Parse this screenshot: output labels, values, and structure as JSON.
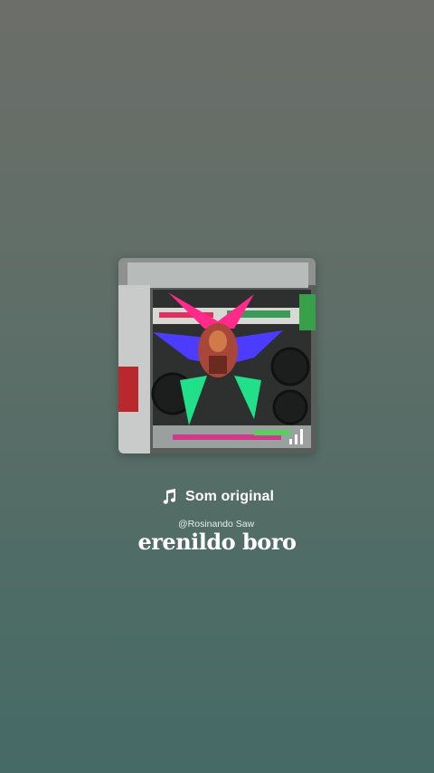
{
  "sound": {
    "icon": "music-note-icon",
    "title": "Som original"
  },
  "overlay": {
    "handle": "@Rosinando Saw",
    "name": "erenildo boro"
  },
  "cover": {
    "indicator_icon": "signal-bars-icon",
    "accent_colors": [
      "#ff2a8a",
      "#4b3cff",
      "#22e08a"
    ]
  }
}
